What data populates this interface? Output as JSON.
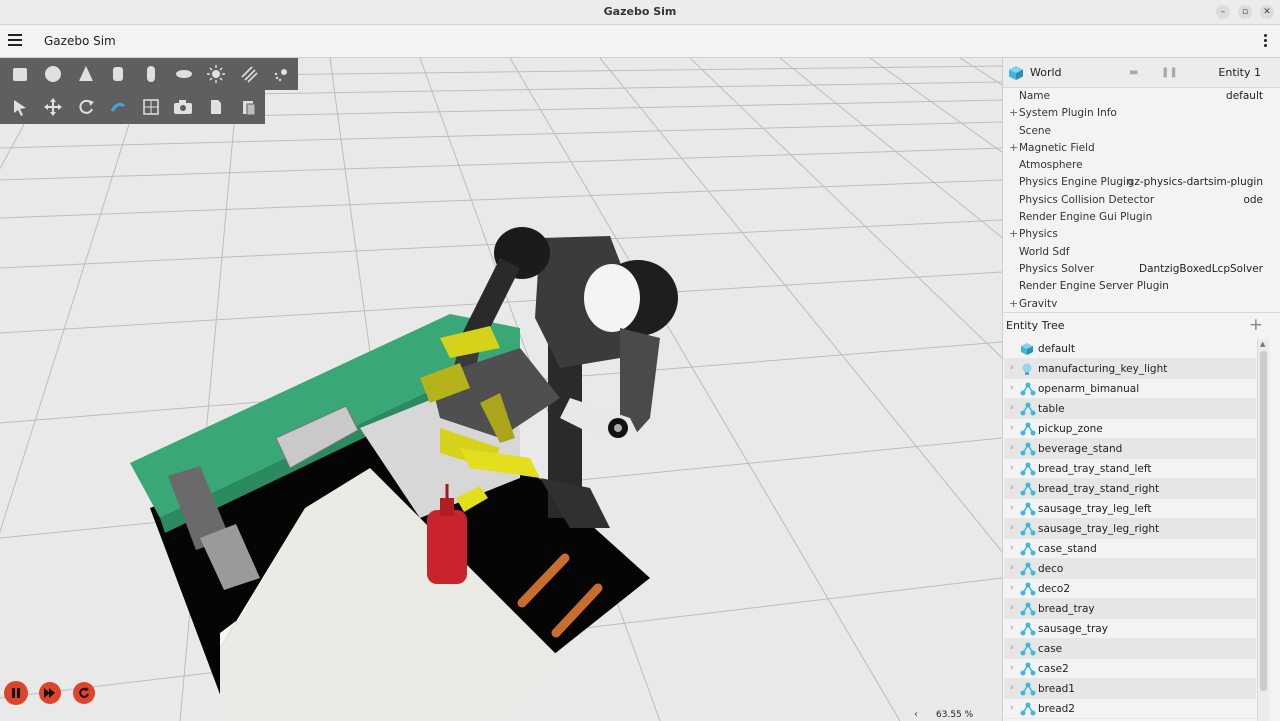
{
  "window": {
    "title": "Gazebo Sim"
  },
  "menubar": {
    "app_title": "Gazebo Sim"
  },
  "viewport": {
    "zoom": "63.55 %"
  },
  "toolbar_top": [
    "box-icon",
    "sphere-icon",
    "cone-icon",
    "cylinder-icon",
    "capsule-icon",
    "ellipsoid-icon",
    "sun-light-icon",
    "directional-light-icon",
    "spot-light-icon"
  ],
  "toolbar_bottom": [
    "select-icon",
    "translate-icon",
    "rotate-icon",
    "snap-icon",
    "grid-icon",
    "camera-icon",
    "copy-icon",
    "paste-icon"
  ],
  "component_inspector": {
    "world_label": "World",
    "entity_label": "Entity 1",
    "properties": [
      {
        "name": "Name",
        "value": "default",
        "expandable": false
      },
      {
        "name": "System Plugin Info",
        "value": "",
        "expandable": true
      },
      {
        "name": "Scene",
        "value": "",
        "expandable": false
      },
      {
        "name": "Magnetic Field",
        "value": "",
        "expandable": true
      },
      {
        "name": "Atmosphere",
        "value": "",
        "expandable": false
      },
      {
        "name": "Physics Engine Plugin",
        "value": "gz-physics-dartsim-plugin",
        "expandable": false
      },
      {
        "name": "Physics Collision Detector",
        "value": "ode",
        "expandable": false
      },
      {
        "name": "Render Engine Gui Plugin",
        "value": "",
        "expandable": false
      },
      {
        "name": "Physics",
        "value": "",
        "expandable": true
      },
      {
        "name": "World Sdf",
        "value": "",
        "expandable": false
      },
      {
        "name": "Physics Solver",
        "value": "DantzigBoxedLcpSolver",
        "expandable": false
      },
      {
        "name": "Render Engine Server Plugin",
        "value": "",
        "expandable": false
      },
      {
        "name": "Gravity",
        "value": "",
        "expandable": true
      }
    ]
  },
  "entity_tree": {
    "title": "Entity Tree",
    "items": [
      {
        "name": "default",
        "icon": "world-icon",
        "chevron": false
      },
      {
        "name": "manufacturing_key_light",
        "icon": "light-icon",
        "chevron": true
      },
      {
        "name": "openarm_bimanual",
        "icon": "model-icon",
        "chevron": true
      },
      {
        "name": "table",
        "icon": "model-icon",
        "chevron": true
      },
      {
        "name": "pickup_zone",
        "icon": "model-icon",
        "chevron": true
      },
      {
        "name": "beverage_stand",
        "icon": "model-icon",
        "chevron": true
      },
      {
        "name": "bread_tray_stand_left",
        "icon": "model-icon",
        "chevron": true
      },
      {
        "name": "bread_tray_stand_right",
        "icon": "model-icon",
        "chevron": true
      },
      {
        "name": "sausage_tray_leg_left",
        "icon": "model-icon",
        "chevron": true
      },
      {
        "name": "sausage_tray_leg_right",
        "icon": "model-icon",
        "chevron": true
      },
      {
        "name": "case_stand",
        "icon": "model-icon",
        "chevron": true
      },
      {
        "name": "deco",
        "icon": "model-icon",
        "chevron": true
      },
      {
        "name": "deco2",
        "icon": "model-icon",
        "chevron": true
      },
      {
        "name": "bread_tray",
        "icon": "model-icon",
        "chevron": true
      },
      {
        "name": "sausage_tray",
        "icon": "model-icon",
        "chevron": true
      },
      {
        "name": "case",
        "icon": "model-icon",
        "chevron": true
      },
      {
        "name": "case2",
        "icon": "model-icon",
        "chevron": true
      },
      {
        "name": "bread1",
        "icon": "model-icon",
        "chevron": true
      },
      {
        "name": "bread2",
        "icon": "model-icon",
        "chevron": true
      }
    ]
  },
  "colors": {
    "accent_cube": "#3fb6e0",
    "play_control": "#e0432b",
    "toolbar": "#5f5f5f",
    "table_green": "#3aa876",
    "arm_yellow": "#d6d21a"
  }
}
